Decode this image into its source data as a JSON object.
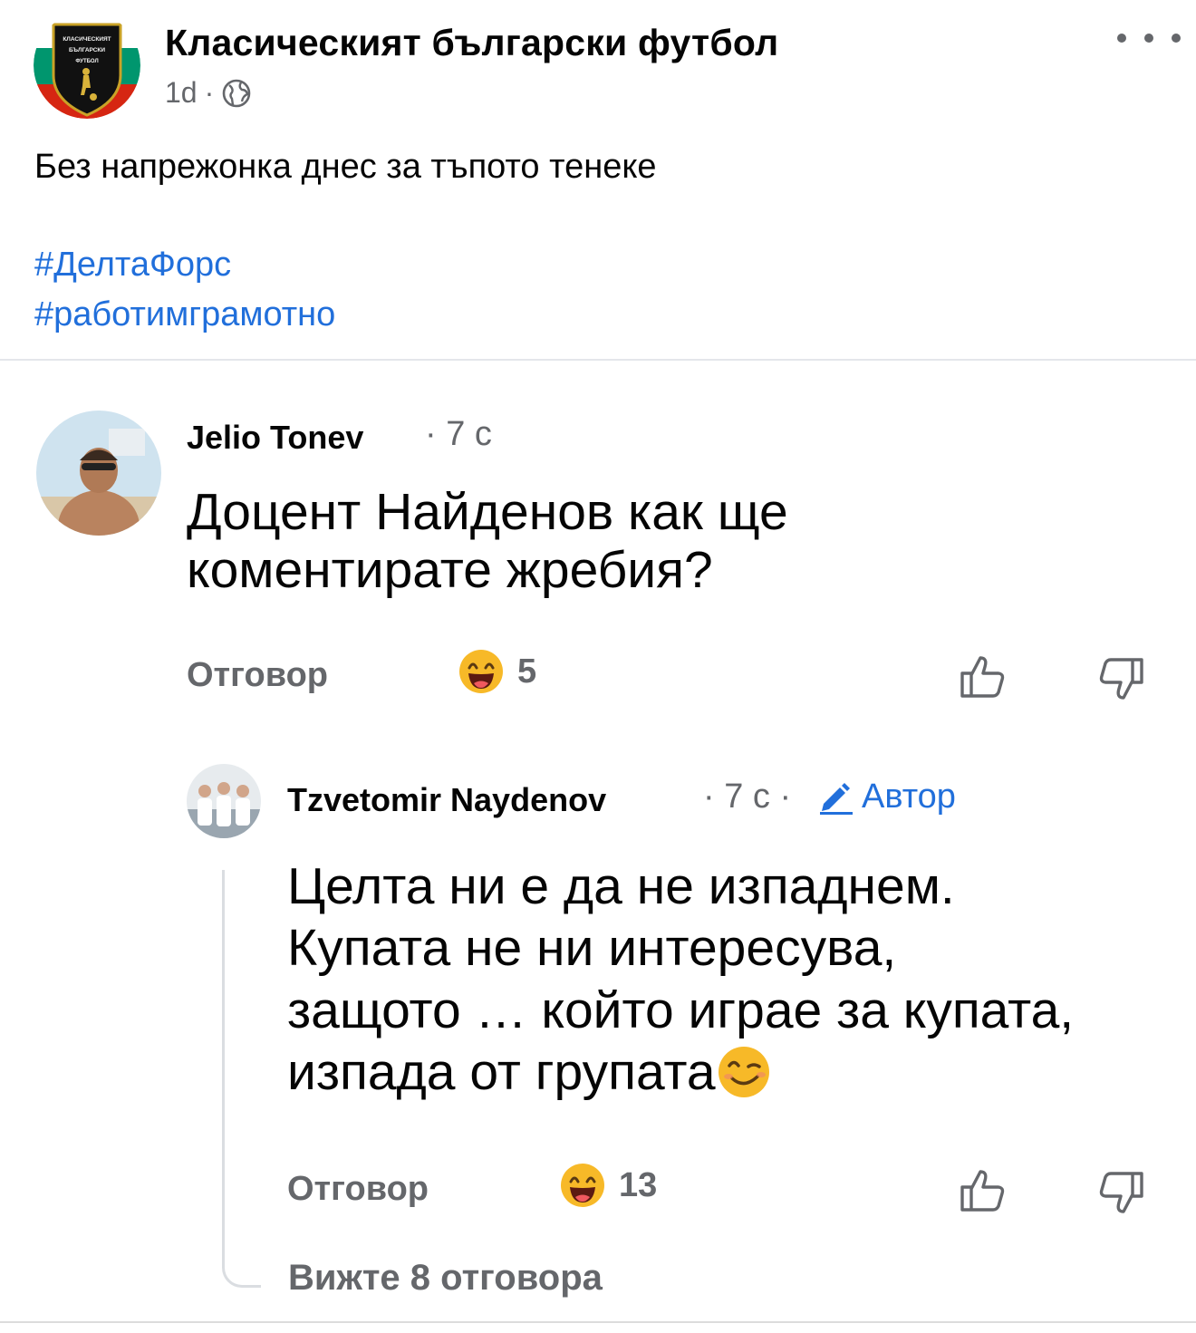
{
  "post": {
    "page_name": "Класическият български футбол",
    "time": "1d",
    "separator": "·",
    "privacy_icon": "globe-icon",
    "more_icon": "more-horizontal-icon",
    "logo_text": [
      "КЛАСИЧЕСКИЯТ",
      "БЪЛГАРСКИ",
      "ФУТБОЛ"
    ],
    "text": "Без напрежонка днес за тъпото тенеке",
    "hashtags": [
      "#ДелтаФорс",
      "#работимграмотно"
    ]
  },
  "comments": [
    {
      "author": "Jelio Tonev",
      "time": "· 7 с",
      "lines": [
        "Доцент Найденов как ще",
        "коментирате жребия?"
      ],
      "reply_label": "Отговор",
      "reaction_emoji": "laughing-emoji",
      "reaction_count": "5",
      "like_icon": "thumbs-up-icon",
      "dislike_icon": "thumbs-down-icon"
    },
    {
      "author": "Tzvetomir Naydenov",
      "time": "· 7 с ·",
      "badge_icon": "pencil-icon",
      "badge": "Автор",
      "lines": [
        "Целта ни е да не изпаднем.",
        "Купата не ни интересува,",
        "защото … който играе за купата,",
        "изпада от групата"
      ],
      "inline_emoji": "winking-emoji",
      "reply_label": "Отговор",
      "reaction_emoji": "laughing-emoji",
      "reaction_count": "13",
      "like_icon": "thumbs-up-icon",
      "dislike_icon": "thumbs-down-icon"
    }
  ],
  "view_replies": "Вижте 8 отговора",
  "colors": {
    "link": "#216fdb",
    "secondary_text": "#65676b",
    "flag_white": "#ffffff",
    "flag_green": "#00966e",
    "flag_red": "#d62612"
  }
}
